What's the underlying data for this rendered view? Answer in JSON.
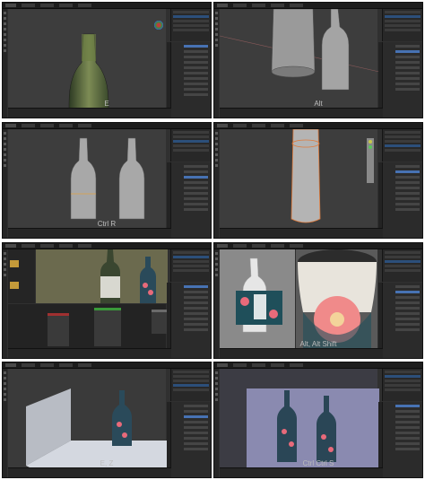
{
  "panels": [
    {
      "id": 1,
      "caption": "E"
    },
    {
      "id": 2,
      "caption": "Alt"
    },
    {
      "id": 3,
      "caption": "Ctrl R"
    },
    {
      "id": 4,
      "caption": ""
    },
    {
      "id": 5,
      "caption": ""
    },
    {
      "id": 6,
      "caption": "Alt, Alt Shift"
    },
    {
      "id": 7,
      "caption": "E, Z"
    },
    {
      "id": 8,
      "caption": "Ctrl Ctrl S"
    }
  ],
  "colors": {
    "viewport_bg": "#3d3d3d",
    "ui_dark": "#1d1d1d",
    "select_blue": "#4772b3",
    "label_teal": "#1f4f5a",
    "flower_pink": "#e86a7a"
  }
}
